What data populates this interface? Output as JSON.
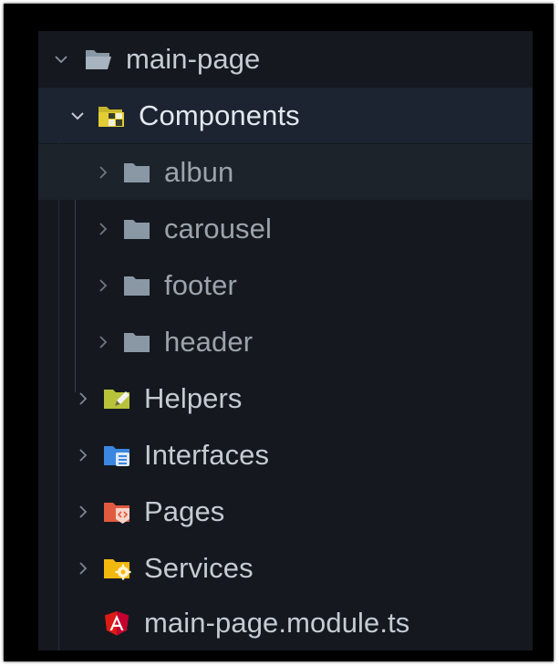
{
  "explorer": {
    "root": {
      "label": "main-page",
      "expanded": true
    },
    "components": {
      "label": "Components",
      "expanded": true
    },
    "component_children": [
      {
        "label": "albun"
      },
      {
        "label": "carousel"
      },
      {
        "label": "footer"
      },
      {
        "label": "header"
      }
    ],
    "folders": [
      {
        "label": "Helpers"
      },
      {
        "label": "Interfaces"
      },
      {
        "label": "Pages"
      },
      {
        "label": "Services"
      }
    ],
    "file": {
      "label": "main-page.module.ts"
    }
  },
  "colors": {
    "panel_bg": "#15191f",
    "text": "#c4cbd4",
    "folder_grey": "#8a98a6",
    "helpers_icon": "#b9c33a",
    "interfaces_icon": "#3b86e0",
    "pages_icon": "#e05a40",
    "services_icon": "#f2b80f",
    "angular_icon": "#dd1b16"
  }
}
